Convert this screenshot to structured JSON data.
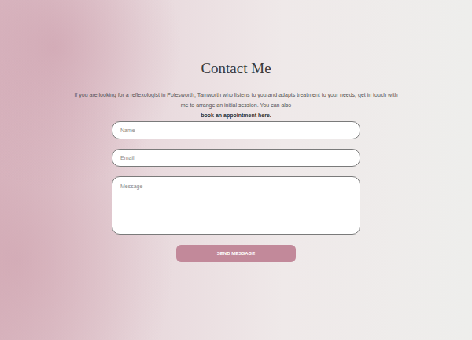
{
  "heading": "Contact Me",
  "intro": "If you are looking for a reflexologist in Polesworth, Tamworth who listens to you and adapts treatment to your needs, get in touch with me to arrange an initial session. You can also",
  "link": "book an appointment here.",
  "fields": [
    {
      "placeholder": "Name",
      "kind": "input"
    },
    {
      "placeholder": "Email",
      "kind": "input"
    },
    {
      "placeholder": "Message",
      "kind": "textarea"
    }
  ],
  "button": "SEND MESSAGE"
}
